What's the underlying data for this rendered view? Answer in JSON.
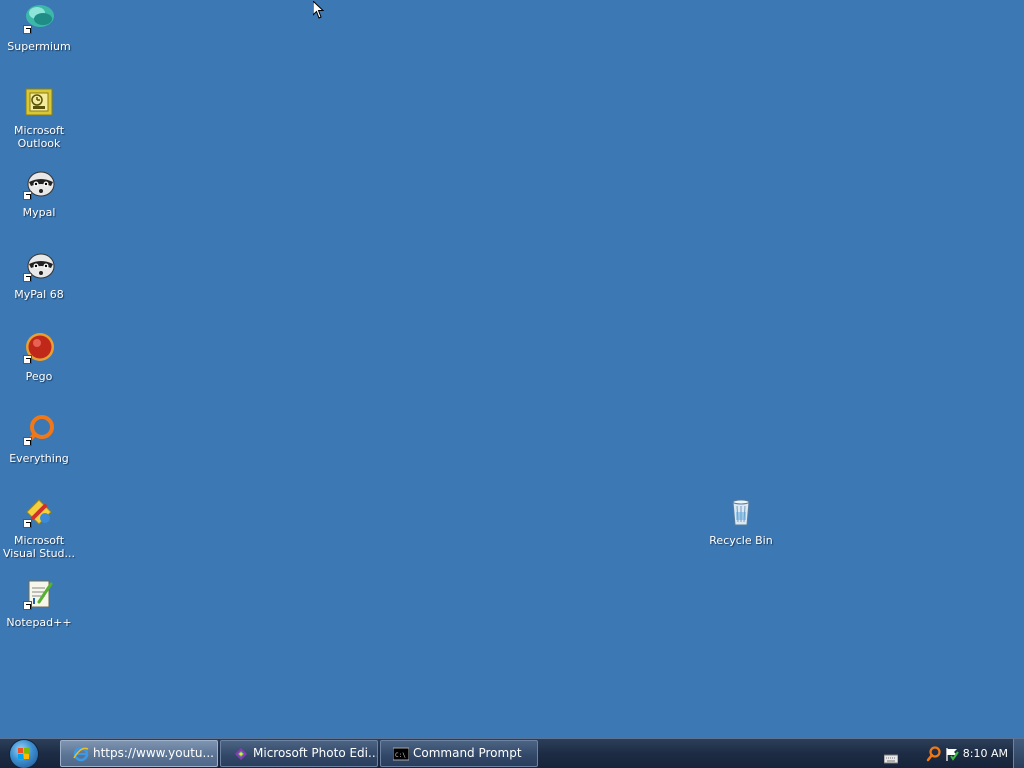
{
  "desktop": {
    "icons": [
      {
        "label": "Supermium",
        "icon": "supermium-icon"
      },
      {
        "label": "Microsoft Outlook",
        "icon": "outlook-icon"
      },
      {
        "label": "Mypal",
        "icon": "mypal-icon"
      },
      {
        "label": "MyPal 68",
        "icon": "mypal68-icon"
      },
      {
        "label": "Pego",
        "icon": "pego-icon"
      },
      {
        "label": "Everything",
        "icon": "everything-icon"
      },
      {
        "label": "Microsoft Visual Stud...",
        "icon": "visual-studio-icon"
      },
      {
        "label": "Notepad++",
        "icon": "notepadpp-icon"
      }
    ],
    "recycle_bin": {
      "label": "Recycle Bin",
      "icon": "recycle-bin-icon"
    }
  },
  "taskbar": {
    "tasks": [
      {
        "label": "https://www.youtu...",
        "icon": "internet-explorer-icon",
        "active": true
      },
      {
        "label": "Microsoft Photo Edi...",
        "icon": "photo-editor-icon",
        "active": false
      },
      {
        "label": "Command Prompt",
        "icon": "command-prompt-icon",
        "active": false
      }
    ],
    "tray": {
      "clock": "8:10 AM",
      "icons": [
        "keyboard-icon",
        "search-icon",
        "flag-icon"
      ]
    }
  },
  "colors": {
    "desktop_background": "#3c78b4",
    "taskbar": "#1d2c44",
    "label_text": "#ffffff"
  }
}
